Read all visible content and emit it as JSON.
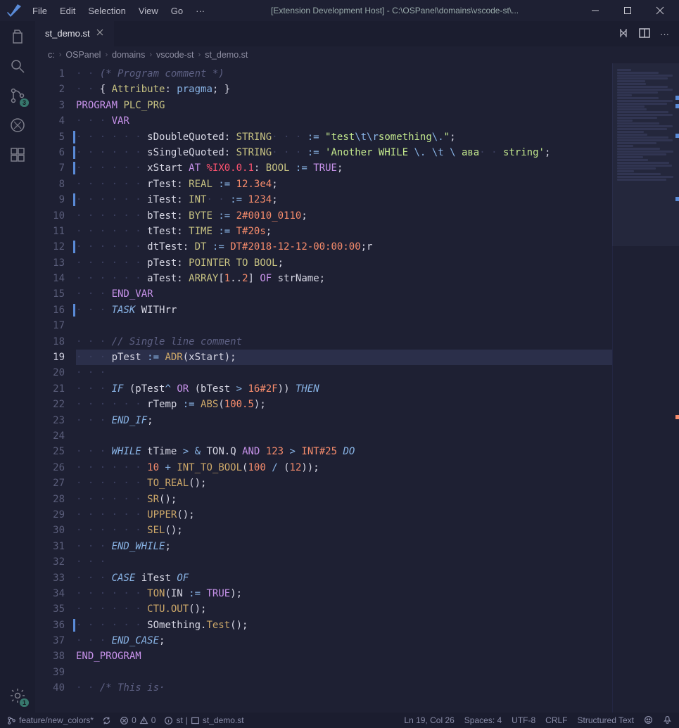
{
  "titlebar": {
    "menu": [
      "File",
      "Edit",
      "Selection",
      "View",
      "Go"
    ],
    "overflow": "···",
    "title": "[Extension Development Host] - C:\\OSPanel\\domains\\vscode-st\\..."
  },
  "activitybar": {
    "scm_badge": "3",
    "settings_badge": "1"
  },
  "tabs": {
    "active": {
      "label": "st_demo.st"
    }
  },
  "breadcrumbs": [
    "c:",
    "OSPanel",
    "domains",
    "vscode-st",
    "st_demo.st"
  ],
  "editor": {
    "line_count": 40,
    "modified_lines": [
      5,
      6,
      7,
      9,
      12,
      16,
      36
    ],
    "current_line_number": 19
  },
  "code_tokens": {
    "l1": [
      [
        "ws",
        "· · "
      ],
      [
        "cmt",
        "(* Program comment *)"
      ]
    ],
    "l2": [
      [
        "ws",
        "· · "
      ],
      [
        "id",
        "{ "
      ],
      [
        "ty",
        "Attribute"
      ],
      [
        "id",
        ": "
      ],
      [
        "prm",
        "pragma"
      ],
      [
        "id",
        "; }"
      ]
    ],
    "l3": [
      [
        "kw",
        "PROGRAM "
      ],
      [
        "ty",
        "PLC_PRG"
      ]
    ],
    "l4": [
      [
        "ws",
        "· · · "
      ],
      [
        "kw",
        "VAR"
      ]
    ],
    "l5": [
      [
        "ws",
        "· · · · · · "
      ],
      [
        "id",
        "sDoubleQuoted: "
      ],
      [
        "ty",
        "STRING"
      ],
      [
        "ws",
        "· · · "
      ],
      [
        "op",
        ":="
      ],
      [
        "id",
        " "
      ],
      [
        "str",
        "\"test"
      ],
      [
        "esc",
        "\\t\\r"
      ],
      [
        "str",
        "something"
      ],
      [
        "esc",
        "\\."
      ],
      [
        "str",
        "\""
      ],
      [
        "id",
        ";"
      ]
    ],
    "l6": [
      [
        "ws",
        "· · · · · · "
      ],
      [
        "id",
        "sSingleQuoted: "
      ],
      [
        "ty",
        "STRING"
      ],
      [
        "ws",
        "· · · "
      ],
      [
        "op",
        ":="
      ],
      [
        "id",
        " "
      ],
      [
        "str",
        "'Another WHILE "
      ],
      [
        "esc",
        "\\."
      ],
      [
        "str",
        " "
      ],
      [
        "esc",
        "\\t"
      ],
      [
        "str",
        " "
      ],
      [
        "esc",
        "\\"
      ],
      [
        "str",
        " ава"
      ],
      [
        "ws",
        "· · "
      ],
      [
        "str",
        "string'"
      ],
      [
        "id",
        ";"
      ]
    ],
    "l7": [
      [
        "ws",
        "· · · · · · "
      ],
      [
        "id",
        "xStart "
      ],
      [
        "kw",
        "AT"
      ],
      [
        "id",
        " "
      ],
      [
        "sys",
        "%IX0.0.1"
      ],
      [
        "id",
        ": "
      ],
      [
        "ty",
        "BOOL"
      ],
      [
        "id",
        " "
      ],
      [
        "op",
        ":="
      ],
      [
        "id",
        " "
      ],
      [
        "kw",
        "TRUE"
      ],
      [
        "id",
        ";"
      ]
    ],
    "l8": [
      [
        "ws",
        "· · · · · · "
      ],
      [
        "id",
        "rTest: "
      ],
      [
        "ty",
        "REAL"
      ],
      [
        "id",
        " "
      ],
      [
        "op",
        ":="
      ],
      [
        "id",
        " "
      ],
      [
        "num",
        "12.3e4"
      ],
      [
        "id",
        ";"
      ]
    ],
    "l9": [
      [
        "ws",
        "· · · · · · "
      ],
      [
        "id",
        "iTest: "
      ],
      [
        "ty",
        "INT"
      ],
      [
        "ws",
        "· · "
      ],
      [
        "op",
        ":="
      ],
      [
        "id",
        " "
      ],
      [
        "num",
        "1234"
      ],
      [
        "id",
        ";"
      ]
    ],
    "l10": [
      [
        "ws",
        "· · · · · · "
      ],
      [
        "id",
        "bTest: "
      ],
      [
        "ty",
        "BYTE"
      ],
      [
        "id",
        " "
      ],
      [
        "op",
        ":="
      ],
      [
        "id",
        " "
      ],
      [
        "num",
        "2#0010_0110"
      ],
      [
        "id",
        ";"
      ]
    ],
    "l11": [
      [
        "ws",
        "· · · · · · "
      ],
      [
        "id",
        "tTest: "
      ],
      [
        "ty",
        "TIME"
      ],
      [
        "id",
        " "
      ],
      [
        "op",
        ":="
      ],
      [
        "id",
        " "
      ],
      [
        "num",
        "T#20s"
      ],
      [
        "id",
        ";"
      ]
    ],
    "l12": [
      [
        "ws",
        "· · · · · · "
      ],
      [
        "id",
        "dtTest: "
      ],
      [
        "ty",
        "DT"
      ],
      [
        "id",
        " "
      ],
      [
        "op",
        ":="
      ],
      [
        "id",
        " "
      ],
      [
        "num",
        "DT#2018-12-12-00:00:00"
      ],
      [
        "id",
        ";r"
      ]
    ],
    "l13": [
      [
        "ws",
        "· · · · · · "
      ],
      [
        "id",
        "pTest: "
      ],
      [
        "ty",
        "POINTER TO BOOL"
      ],
      [
        "id",
        ";"
      ]
    ],
    "l14": [
      [
        "ws",
        "· · · · · · "
      ],
      [
        "id",
        "aTest: "
      ],
      [
        "ty",
        "ARRAY"
      ],
      [
        "id",
        "["
      ],
      [
        "num",
        "1"
      ],
      [
        "id",
        ".."
      ],
      [
        "num",
        "2"
      ],
      [
        "id",
        "] "
      ],
      [
        "kw",
        "OF"
      ],
      [
        "id",
        " strName;"
      ]
    ],
    "l15": [
      [
        "ws",
        "· · · "
      ],
      [
        "kw",
        "END_VAR"
      ]
    ],
    "l16": [
      [
        "ws",
        "· · · "
      ],
      [
        "ctl",
        "TASK"
      ],
      [
        "id",
        " WITHrr"
      ]
    ],
    "l17": [],
    "l18": [
      [
        "ws",
        "· · · "
      ],
      [
        "cmt",
        "// Single line comment"
      ]
    ],
    "l19": [
      [
        "ws",
        "· · · "
      ],
      [
        "id",
        "pTest "
      ],
      [
        "op",
        ":="
      ],
      [
        "id",
        " "
      ],
      [
        "fn",
        "ADR"
      ],
      [
        "id",
        "(xStart);"
      ]
    ],
    "l20": [
      [
        "ws",
        "· · · "
      ]
    ],
    "l21": [
      [
        "ws",
        "· · · "
      ],
      [
        "ctl",
        "IF"
      ],
      [
        "id",
        " (pTest"
      ],
      [
        "op",
        "^"
      ],
      [
        "id",
        " "
      ],
      [
        "kw",
        "OR"
      ],
      [
        "id",
        " (bTest "
      ],
      [
        "op",
        ">"
      ],
      [
        "id",
        " "
      ],
      [
        "num",
        "16#2F"
      ],
      [
        "id",
        ")) "
      ],
      [
        "ctl",
        "THEN"
      ]
    ],
    "l22": [
      [
        "ws",
        "· · · · · · "
      ],
      [
        "id",
        "rTemp "
      ],
      [
        "op",
        ":="
      ],
      [
        "id",
        " "
      ],
      [
        "fn",
        "ABS"
      ],
      [
        "id",
        "("
      ],
      [
        "num",
        "100.5"
      ],
      [
        "id",
        ");"
      ]
    ],
    "l23": [
      [
        "ws",
        "· · · "
      ],
      [
        "ctl",
        "END_IF"
      ],
      [
        "id",
        ";"
      ]
    ],
    "l24": [],
    "l25": [
      [
        "ws",
        "· · · "
      ],
      [
        "ctl",
        "WHILE"
      ],
      [
        "id",
        " tTime "
      ],
      [
        "op",
        ">"
      ],
      [
        "id",
        " "
      ],
      [
        "op",
        "&"
      ],
      [
        "id",
        " TON.Q "
      ],
      [
        "kw",
        "AND"
      ],
      [
        "id",
        " "
      ],
      [
        "num",
        "123"
      ],
      [
        "id",
        " "
      ],
      [
        "op",
        ">"
      ],
      [
        "id",
        " "
      ],
      [
        "num",
        "INT#25"
      ],
      [
        "id",
        " "
      ],
      [
        "ctl",
        "DO"
      ]
    ],
    "l26": [
      [
        "ws",
        "· · · · · · "
      ],
      [
        "num",
        "10"
      ],
      [
        "id",
        " "
      ],
      [
        "op",
        "+"
      ],
      [
        "id",
        " "
      ],
      [
        "fn",
        "INT_TO_BOOL"
      ],
      [
        "id",
        "("
      ],
      [
        "num",
        "100"
      ],
      [
        "id",
        " "
      ],
      [
        "op",
        "/"
      ],
      [
        "id",
        " ("
      ],
      [
        "num",
        "12"
      ],
      [
        "id",
        "));"
      ]
    ],
    "l27": [
      [
        "ws",
        "· · · · · · "
      ],
      [
        "fn",
        "TO_REAL"
      ],
      [
        "id",
        "();"
      ]
    ],
    "l28": [
      [
        "ws",
        "· · · · · · "
      ],
      [
        "fn",
        "SR"
      ],
      [
        "id",
        "();"
      ]
    ],
    "l29": [
      [
        "ws",
        "· · · · · · "
      ],
      [
        "fn",
        "UPPER"
      ],
      [
        "id",
        "();"
      ]
    ],
    "l30": [
      [
        "ws",
        "· · · · · · "
      ],
      [
        "fn",
        "SEL"
      ],
      [
        "id",
        "();"
      ]
    ],
    "l31": [
      [
        "ws",
        "· · · "
      ],
      [
        "ctl",
        "END_WHILE"
      ],
      [
        "id",
        ";"
      ]
    ],
    "l32": [
      [
        "ws",
        "· · · "
      ]
    ],
    "l33": [
      [
        "ws",
        "· · · "
      ],
      [
        "ctl",
        "CASE"
      ],
      [
        "id",
        " iTest "
      ],
      [
        "ctl",
        "OF"
      ]
    ],
    "l34": [
      [
        "ws",
        "· · · · · · "
      ],
      [
        "fn",
        "TON"
      ],
      [
        "id",
        "(IN "
      ],
      [
        "op",
        ":="
      ],
      [
        "id",
        " "
      ],
      [
        "kw",
        "TRUE"
      ],
      [
        "id",
        ");"
      ]
    ],
    "l35": [
      [
        "ws",
        "· · · · · · "
      ],
      [
        "fn",
        "CTU.OUT"
      ],
      [
        "id",
        "();"
      ]
    ],
    "l36": [
      [
        "ws",
        "· · · · · · "
      ],
      [
        "id",
        "SOmething."
      ],
      [
        "fn",
        "Test"
      ],
      [
        "id",
        "();"
      ]
    ],
    "l37": [
      [
        "ws",
        "· · · "
      ],
      [
        "ctl",
        "END_CASE"
      ],
      [
        "id",
        ";"
      ]
    ],
    "l38": [
      [
        "kw",
        "END_PROGRAM"
      ]
    ],
    "l39": [],
    "l40": [
      [
        "ws",
        "· · "
      ],
      [
        "cmt",
        "/* This is·"
      ]
    ]
  },
  "statusbar": {
    "branch": "feature/new_colors*",
    "errors": "0",
    "warnings": "0",
    "info": "st",
    "file": "st_demo.st",
    "cursor": "Ln 19, Col 26",
    "spaces": "Spaces: 4",
    "encoding": "UTF-8",
    "eol": "CRLF",
    "lang": "Structured Text"
  }
}
